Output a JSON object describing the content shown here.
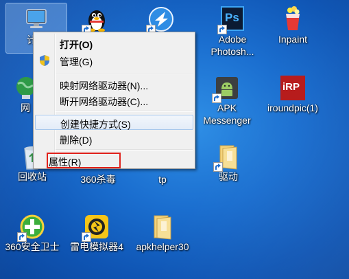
{
  "desktop": {
    "icons": [
      {
        "label": "计算机"
      },
      {
        "label": "QQ"
      },
      {
        "label": ""
      },
      {
        "label_line1": "Adobe",
        "label_line2": "Photosh...",
        "badge": "Ps"
      },
      {
        "label": "Inpaint"
      },
      {
        "label": "网络"
      },
      {
        "label_line1": "APK",
        "label_line2": "Messenger"
      },
      {
        "label": "iroundpic(1)",
        "badge": "iRP"
      },
      {
        "label": "回收站"
      },
      {
        "label": "360杀毒"
      },
      {
        "label": "tp"
      },
      {
        "label": "驱动"
      },
      {
        "label": "360安全卫士"
      },
      {
        "label": "雷电模拟器4"
      },
      {
        "label": "apkhelper30"
      }
    ],
    "partial_labels": {
      "computer_visible": "计算",
      "network_visible": "网"
    }
  },
  "context_menu": {
    "items": [
      {
        "label": "打开(O)",
        "bold": true
      },
      {
        "label": "管理(G)",
        "icon": "shield-icon"
      },
      {
        "label": "映射网络驱动器(N)..."
      },
      {
        "label": "断开网络驱动器(C)..."
      },
      {
        "label": "创建快捷方式(S)"
      },
      {
        "label": "删除(D)"
      },
      {
        "label": "属性(R)"
      }
    ]
  },
  "colors": {
    "desktop_blue": "#1b6fd0",
    "menu_background": "#f0f0f0",
    "annotation_red": "#e0201a"
  }
}
